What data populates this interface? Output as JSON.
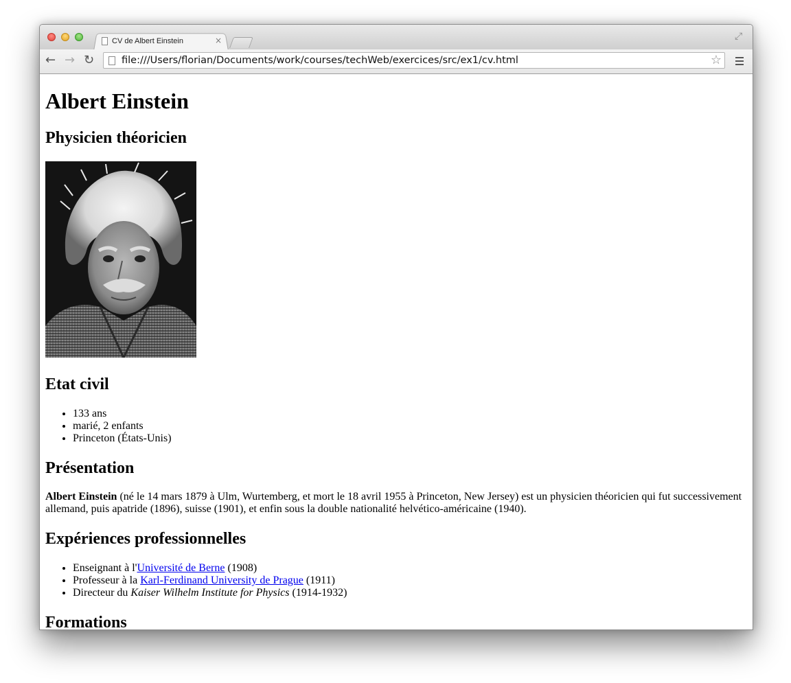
{
  "browser": {
    "tab_title": "CV de Albert Einstein",
    "tab_close": "×",
    "url": "file:///Users/florian/Documents/work/courses/techWeb/exercices/src/ex1/cv.html",
    "back": "←",
    "forward": "→",
    "reload": "↻",
    "bookmark": "☆",
    "fullscreen": "⤢"
  },
  "page": {
    "name": "Albert Einstein",
    "subtitle": "Physicien théoricien",
    "etat_civil": {
      "heading": "Etat civil",
      "items": [
        "133 ans",
        "marié, 2 enfants",
        "Princeton (États-Unis)"
      ]
    },
    "presentation": {
      "heading": "Présentation",
      "bold_name": "Albert Einstein",
      "text": " (né le 14 mars 1879 à Ulm, Wurtemberg, et mort le 18 avril 1955 à Princeton, New Jersey) est un physicien théoricien qui fut successivement allemand, puis apatride (1896), suisse (1901), et enfin sous la double nationalité helvético-américaine (1940)."
    },
    "experiences": {
      "heading": "Expériences professionnelles",
      "items": [
        {
          "prefix": "Enseignant à l'",
          "link": "Université de Berne",
          "suffix": " (1908)"
        },
        {
          "prefix": "Professeur à la ",
          "link": "Karl-Ferdinand University de Prague",
          "suffix": " (1911)"
        },
        {
          "prefix": "Directeur du ",
          "italic": "Kaiser Wilhelm Institute for Physics",
          "suffix": " (1914-1932)"
        }
      ]
    },
    "formations": {
      "heading": "Formations"
    }
  }
}
